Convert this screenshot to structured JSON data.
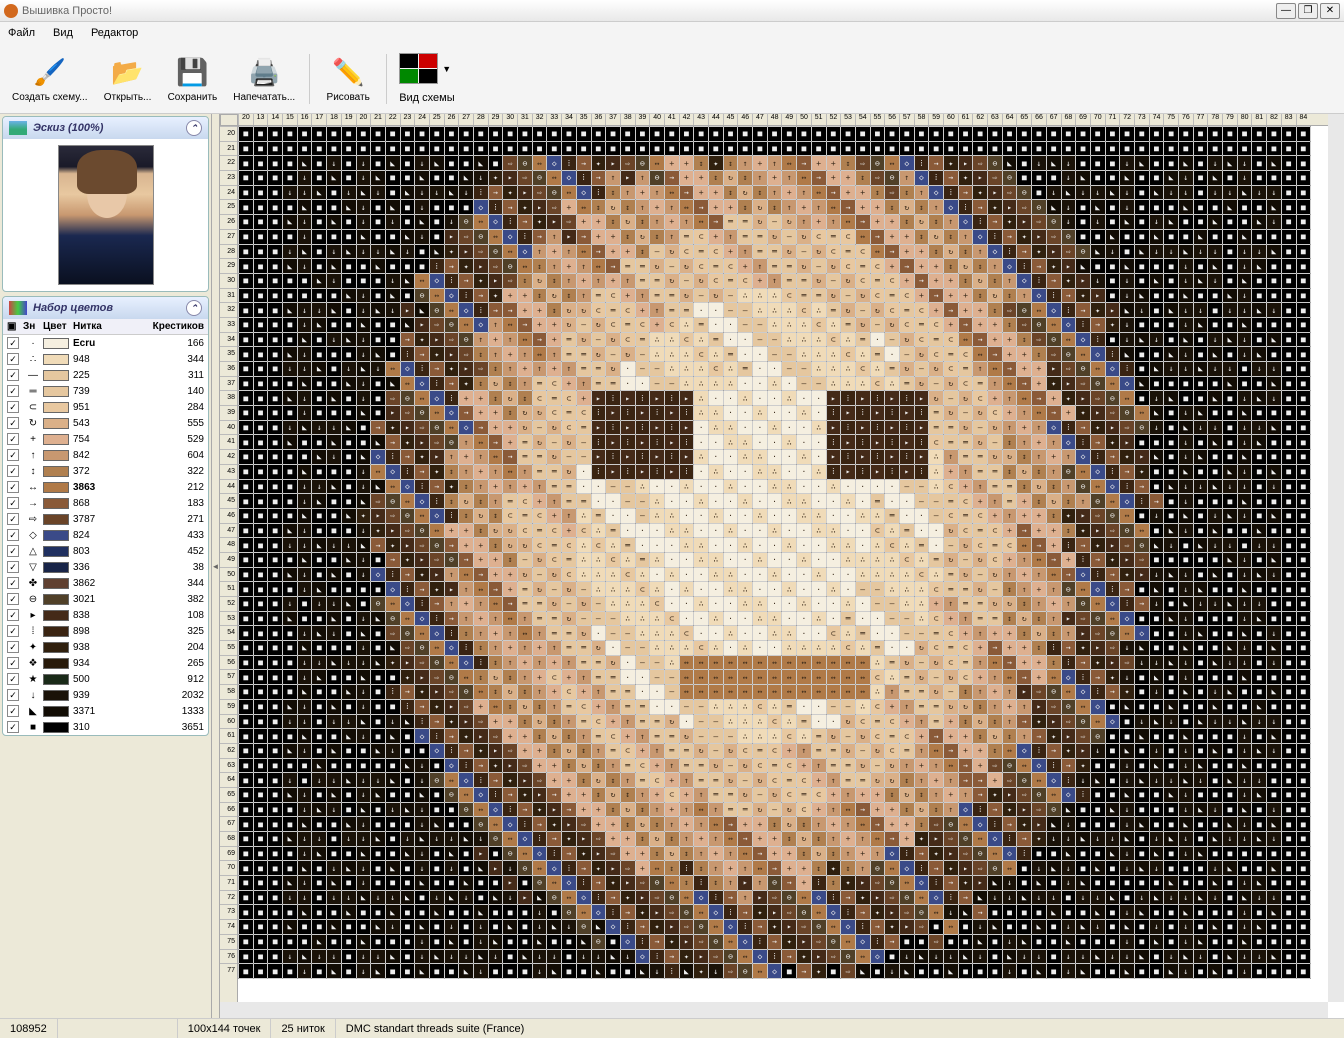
{
  "window": {
    "title": "Вышивка Просто!"
  },
  "menu": {
    "file": "Файл",
    "view": "Вид",
    "editor": "Редактор"
  },
  "toolbar": {
    "create": "Создать схему...",
    "open": "Открыть...",
    "save": "Сохранить",
    "print": "Напечатать...",
    "draw": "Рисовать",
    "viewscheme": "Вид схемы"
  },
  "panels": {
    "sketch": "Эскиз (100%)",
    "colorset": "Набор цветов"
  },
  "color_headers": {
    "zn": "Зн",
    "color": "Цвет",
    "thread": "Нитка",
    "crosses": "Крестиков"
  },
  "colors": [
    {
      "sym": "·",
      "swatch": "#f5efe0",
      "thread": "Ecru",
      "count": 166,
      "bold": true
    },
    {
      "sym": "∴",
      "swatch": "#f0dbb8",
      "thread": "948",
      "count": 344
    },
    {
      "sym": "—",
      "swatch": "#e5c79f",
      "thread": "225",
      "count": 311
    },
    {
      "sym": "═",
      "swatch": "#e5c79f",
      "thread": "739",
      "count": 140
    },
    {
      "sym": "⊂",
      "swatch": "#e8c8a0",
      "thread": "951",
      "count": 284
    },
    {
      "sym": "↻",
      "swatch": "#dab088",
      "thread": "543",
      "count": 555
    },
    {
      "sym": "+",
      "swatch": "#deb090",
      "thread": "754",
      "count": 529
    },
    {
      "sym": "↑",
      "swatch": "#c89870",
      "thread": "842",
      "count": 604
    },
    {
      "sym": "↕",
      "swatch": "#b08050",
      "thread": "372",
      "count": 322
    },
    {
      "sym": "↔",
      "swatch": "#b07a48",
      "thread": "3863",
      "count": 212,
      "bold": true
    },
    {
      "sym": "→",
      "swatch": "#8a5a38",
      "thread": "868",
      "count": 183
    },
    {
      "sym": "⇨",
      "swatch": "#6a4428",
      "thread": "3787",
      "count": 271
    },
    {
      "sym": "◇",
      "swatch": "#3a4a88",
      "thread": "824",
      "count": 433
    },
    {
      "sym": "△",
      "swatch": "#203060",
      "thread": "803",
      "count": 452
    },
    {
      "sym": "▽",
      "swatch": "#182448",
      "thread": "336",
      "count": 38
    },
    {
      "sym": "✤",
      "swatch": "#604030",
      "thread": "3862",
      "count": 344
    },
    {
      "sym": "⊖",
      "swatch": "#504028",
      "thread": "3021",
      "count": 382
    },
    {
      "sym": "▸",
      "swatch": "#442a18",
      "thread": "838",
      "count": 108
    },
    {
      "sym": "⁞",
      "swatch": "#3a2412",
      "thread": "898",
      "count": 325
    },
    {
      "sym": "✦",
      "swatch": "#30200e",
      "thread": "938",
      "count": 204
    },
    {
      "sym": "❖",
      "swatch": "#281a0a",
      "thread": "934",
      "count": 265
    },
    {
      "sym": "★",
      "swatch": "#1a2a18",
      "thread": "500",
      "count": 912
    },
    {
      "sym": "↓",
      "swatch": "#1a1208",
      "thread": "939",
      "count": 2032
    },
    {
      "sym": "◣",
      "swatch": "#120c04",
      "thread": "3371",
      "count": 1333
    },
    {
      "sym": "■",
      "swatch": "#000000",
      "thread": "310",
      "count": 3651
    }
  ],
  "ruler": {
    "cols": [
      20,
      13,
      14,
      15,
      16,
      17,
      18,
      19,
      20,
      21,
      22,
      23,
      24,
      25,
      26,
      27,
      28,
      29,
      30,
      31,
      32,
      33,
      34,
      35,
      36,
      37,
      38,
      39,
      40,
      41,
      42,
      43,
      44,
      45,
      46,
      47,
      48,
      49,
      50,
      51,
      52,
      53,
      54,
      55,
      56,
      57,
      58,
      59,
      60,
      61,
      62,
      63,
      64,
      65,
      66,
      67,
      68,
      69,
      70,
      71,
      72,
      73,
      74,
      75,
      76,
      77,
      78,
      79,
      80,
      81,
      82,
      83,
      84
    ],
    "rows": [
      20,
      21,
      22,
      23,
      24,
      25,
      26,
      27,
      28,
      29,
      30,
      31,
      32,
      33,
      34,
      35,
      36,
      37,
      38,
      39,
      40,
      41,
      42,
      43,
      44,
      45,
      46,
      47,
      48,
      49,
      50,
      51,
      52,
      53,
      54,
      55,
      56,
      57,
      58,
      59,
      60,
      61,
      62,
      63,
      64,
      65,
      66,
      67,
      68,
      69,
      70,
      71,
      72,
      73,
      74,
      75,
      76,
      77
    ]
  },
  "status": {
    "id": "108952",
    "dims": "100x144 точек",
    "threads": "25 ниток",
    "suite": "DMC standart threads suite (France)"
  }
}
